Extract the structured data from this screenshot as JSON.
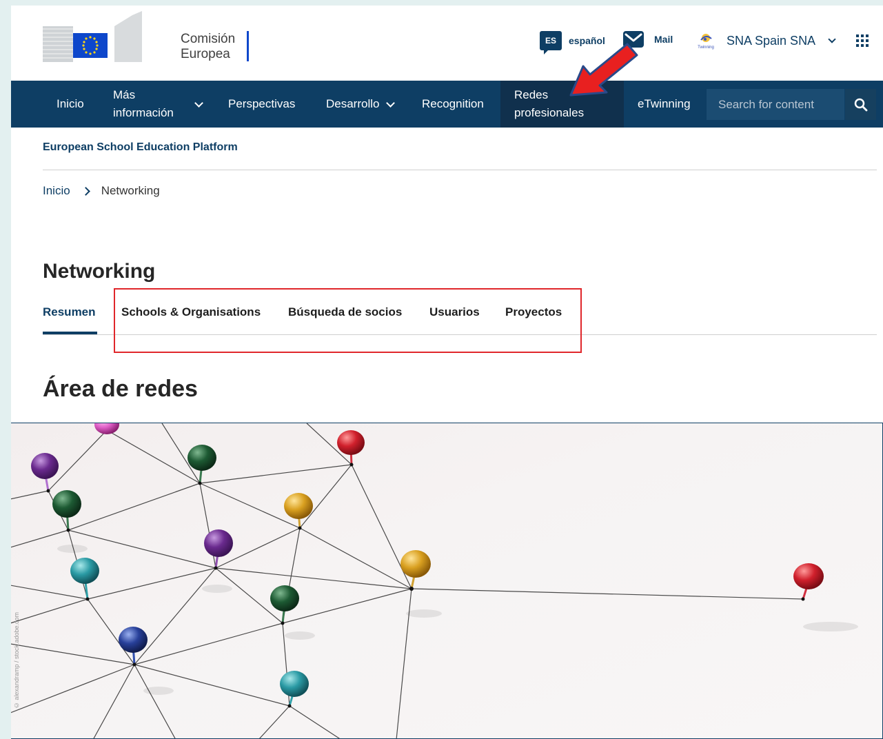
{
  "header": {
    "logo_line1": "Comisión",
    "logo_line2": "Europea",
    "lang_code": "ES",
    "lang_label": "español",
    "mail_label": "Mail",
    "user_label": "SNA Spain SNA",
    "user_badge_text": "Twinning"
  },
  "nav": {
    "items": [
      {
        "label": "Inicio"
      },
      {
        "label": "Más información"
      },
      {
        "label": "Perspectivas"
      },
      {
        "label": "Desarrollo"
      },
      {
        "label": "Recognition"
      },
      {
        "label": "Redes profesionales"
      },
      {
        "label": "eTwinning"
      }
    ],
    "search_placeholder": "Search for content"
  },
  "platform_name": "European School Education Platform",
  "breadcrumb": {
    "home": "Inicio",
    "current": "Networking"
  },
  "page_title": "Networking",
  "tabs": [
    {
      "label": "Resumen",
      "selected": true
    },
    {
      "label": "Schools & Organisations",
      "selected": false
    },
    {
      "label": "Búsqueda de socios",
      "selected": false
    },
    {
      "label": "Usuarios",
      "selected": false
    },
    {
      "label": "Proyectos",
      "selected": false
    }
  ],
  "section_title": "Área de redes",
  "image_credit": "© alexandramp / stock.adobe.com",
  "colors": {
    "brand_navy": "#0e3e64",
    "ec_blue": "#0e47cb",
    "highlight_red": "#e0262a",
    "page_background": "#e3f0f0"
  }
}
